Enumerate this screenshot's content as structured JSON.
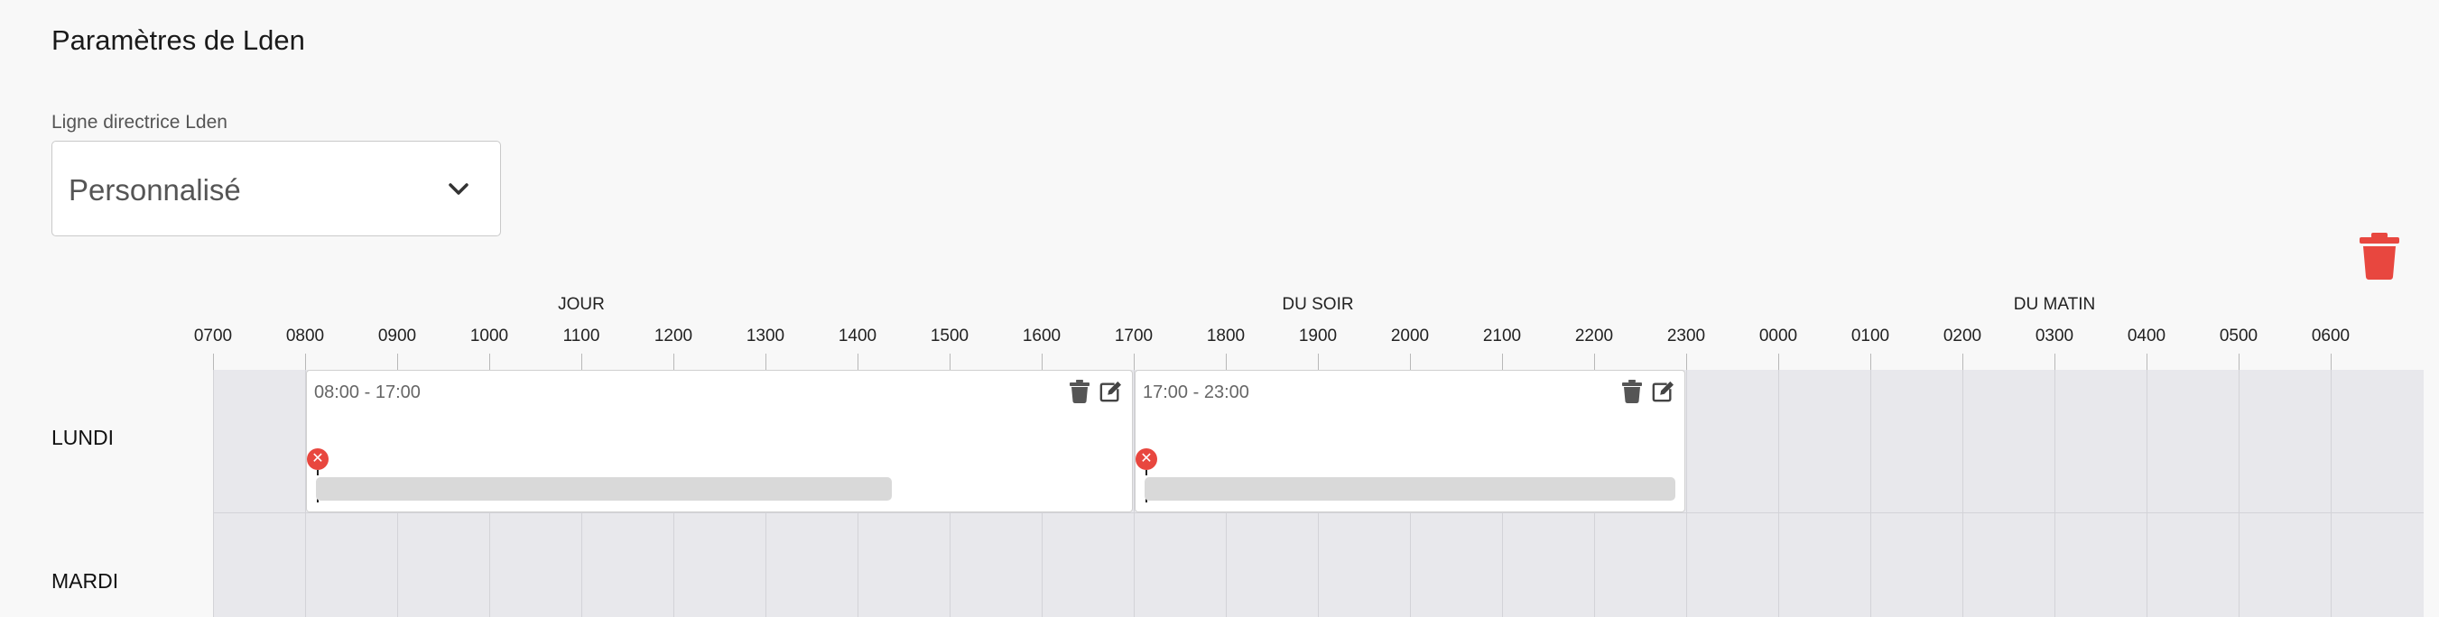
{
  "page": {
    "title": "Paramètres de Lden"
  },
  "guideline": {
    "label": "Ligne directrice Lden",
    "selected": "Personnalisé"
  },
  "sections": [
    {
      "label": "JOUR"
    },
    {
      "label": "DU SOIR"
    },
    {
      "label": "DU MATIN"
    }
  ],
  "hours": [
    "0700",
    "0800",
    "0900",
    "1000",
    "1100",
    "1200",
    "1300",
    "1400",
    "1500",
    "1600",
    "1700",
    "1800",
    "1900",
    "2000",
    "2100",
    "2200",
    "2300",
    "0000",
    "0100",
    "0200",
    "0300",
    "0400",
    "0500",
    "0600"
  ],
  "rows": [
    {
      "label": "LUNDI"
    },
    {
      "label": "MARDI"
    }
  ],
  "events": [
    {
      "time_range": "08:00 - 17:00",
      "row": "LUNDI",
      "start": "08:00",
      "end": "17:00"
    },
    {
      "time_range": "17:00 - 23:00",
      "row": "LUNDI",
      "start": "17:00",
      "end": "23:00"
    }
  ],
  "colors": {
    "danger": "#e8473f",
    "timeline_bg": "#e8e8ec",
    "bar": "#d9d9d9"
  },
  "icons": {
    "delete_all": "trash-icon",
    "event_delete": "trash-icon",
    "event_edit": "edit-icon",
    "select": "chevron-down-icon",
    "marker": "close-icon"
  }
}
